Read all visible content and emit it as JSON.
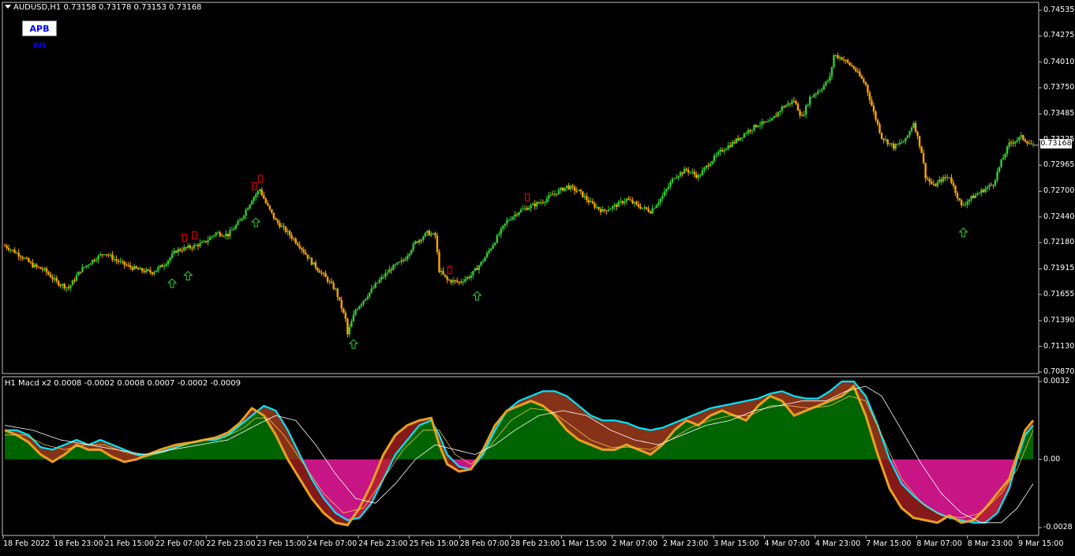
{
  "header": {
    "symbol_info": "AUDUSD,H1  0.73158 0.73178 0.73153 0.73168",
    "apb_button": "APB on",
    "current_price": "0.73168"
  },
  "indicator": {
    "title": "H1 Macd x2 0.0008 -0.0002 0.0008 0.0007 -0.0002 -0.0009"
  },
  "price_axis": {
    "ticks": [
      "0.74535",
      "0.74275",
      "0.74010",
      "0.73750",
      "0.73485",
      "0.73225",
      "0.72965",
      "0.72700",
      "0.72440",
      "0.72180",
      "0.71915",
      "0.71655",
      "0.71390",
      "0.71130",
      "0.70870"
    ]
  },
  "macd_axis": {
    "ticks": [
      "0.0032",
      "0.00",
      "-0.0028"
    ]
  },
  "time_axis": {
    "ticks": [
      "18 Feb 2022",
      "18 Feb 23:00",
      "21 Feb 15:00",
      "22 Feb 07:00",
      "22 Feb 23:00",
      "23 Feb 15:00",
      "24 Feb 07:00",
      "24 Feb 23:00",
      "25 Feb 15:00",
      "28 Feb 07:00",
      "28 Feb 23:00",
      "1 Mar 15:00",
      "2 Mar 07:00",
      "2 Mar 23:00",
      "3 Mar 15:00",
      "4 Mar 07:00",
      "4 Mar 23:00",
      "7 Mar 15:00",
      "8 Mar 07:00",
      "8 Mar 23:00",
      "9 Mar 15:00"
    ]
  },
  "colors": {
    "background": "#000000",
    "bull": "#32cd32",
    "bear": "#ffa500",
    "macd_pos_fill": "#006400",
    "macd_neg_fill": "#c71585",
    "macd_line": "#00e5ff",
    "signal_line": "#e8a020",
    "white_line": "#ffffff",
    "up_arrow": "#32cd32",
    "down_marker": "#ff0000"
  },
  "chart_data": {
    "type": "candlestick",
    "symbol": "AUDUSD",
    "timeframe": "H1",
    "ylim": [
      0.7087,
      0.74535
    ],
    "close_path": [
      [
        0,
        0.7215
      ],
      [
        8,
        0.7205
      ],
      [
        14,
        0.7195
      ],
      [
        20,
        0.719
      ],
      [
        26,
        0.7178
      ],
      [
        32,
        0.7172
      ],
      [
        38,
        0.719
      ],
      [
        44,
        0.72
      ],
      [
        50,
        0.7208
      ],
      [
        56,
        0.72
      ],
      [
        62,
        0.7194
      ],
      [
        68,
        0.719
      ],
      [
        74,
        0.7188
      ],
      [
        80,
        0.7196
      ],
      [
        86,
        0.721
      ],
      [
        94,
        0.7214
      ],
      [
        100,
        0.7218
      ],
      [
        106,
        0.7228
      ],
      [
        112,
        0.7226
      ],
      [
        118,
        0.724
      ],
      [
        124,
        0.7262
      ],
      [
        128,
        0.7272
      ],
      [
        131,
        0.7258
      ],
      [
        136,
        0.724
      ],
      [
        142,
        0.7228
      ],
      [
        148,
        0.7215
      ],
      [
        154,
        0.7198
      ],
      [
        160,
        0.7185
      ],
      [
        166,
        0.717
      ],
      [
        171,
        0.714
      ],
      [
        172,
        0.7125
      ],
      [
        176,
        0.715
      ],
      [
        182,
        0.7165
      ],
      [
        188,
        0.718
      ],
      [
        194,
        0.7192
      ],
      [
        200,
        0.72
      ],
      [
        206,
        0.7218
      ],
      [
        212,
        0.7228
      ],
      [
        216,
        0.7225
      ],
      [
        218,
        0.719
      ],
      [
        222,
        0.718
      ],
      [
        228,
        0.7178
      ],
      [
        234,
        0.7185
      ],
      [
        240,
        0.72
      ],
      [
        246,
        0.722
      ],
      [
        252,
        0.724
      ],
      [
        258,
        0.725
      ],
      [
        264,
        0.7255
      ],
      [
        270,
        0.726
      ],
      [
        276,
        0.7268
      ],
      [
        282,
        0.7275
      ],
      [
        288,
        0.727
      ],
      [
        294,
        0.7258
      ],
      [
        300,
        0.725
      ],
      [
        306,
        0.7255
      ],
      [
        312,
        0.7262
      ],
      [
        318,
        0.7255
      ],
      [
        324,
        0.725
      ],
      [
        330,
        0.7265
      ],
      [
        336,
        0.7285
      ],
      [
        342,
        0.7292
      ],
      [
        348,
        0.7285
      ],
      [
        354,
        0.73
      ],
      [
        360,
        0.7312
      ],
      [
        366,
        0.732
      ],
      [
        372,
        0.733
      ],
      [
        378,
        0.7338
      ],
      [
        384,
        0.734
      ],
      [
        390,
        0.7355
      ],
      [
        396,
        0.7362
      ],
      [
        400,
        0.7345
      ],
      [
        404,
        0.7365
      ],
      [
        410,
        0.7375
      ],
      [
        414,
        0.7385
      ],
      [
        416,
        0.7408
      ],
      [
        420,
        0.7405
      ],
      [
        426,
        0.7395
      ],
      [
        432,
        0.7378
      ],
      [
        436,
        0.735
      ],
      [
        440,
        0.7325
      ],
      [
        446,
        0.7315
      ],
      [
        452,
        0.7322
      ],
      [
        456,
        0.734
      ],
      [
        460,
        0.731
      ],
      [
        462,
        0.7285
      ],
      [
        466,
        0.7275
      ],
      [
        470,
        0.7282
      ],
      [
        474,
        0.7285
      ],
      [
        476,
        0.7275
      ],
      [
        478,
        0.7265
      ],
      [
        480,
        0.7255
      ],
      [
        484,
        0.7262
      ],
      [
        490,
        0.727
      ],
      [
        496,
        0.7278
      ],
      [
        500,
        0.73
      ],
      [
        504,
        0.7318
      ],
      [
        510,
        0.7325
      ],
      [
        516,
        0.7316
      ]
    ],
    "up_arrows": [
      84,
      92,
      126,
      175,
      237,
      481
    ],
    "down_markers": [
      90,
      95,
      125,
      128,
      223,
      262
    ]
  },
  "macd_data": {
    "ylim": [
      -0.0028,
      0.0032
    ],
    "hist": [
      [
        0,
        0.0012
      ],
      [
        6,
        0.0012
      ],
      [
        12,
        0.001
      ],
      [
        18,
        0.0005
      ],
      [
        24,
        0.0004
      ],
      [
        30,
        0.0006
      ],
      [
        36,
        0.0008
      ],
      [
        42,
        0.0006
      ],
      [
        48,
        0.0008
      ],
      [
        54,
        0.0006
      ],
      [
        60,
        0.0004
      ],
      [
        66,
        0.0002
      ],
      [
        72,
        0.0002
      ],
      [
        78,
        0.0003
      ],
      [
        86,
        0.0005
      ],
      [
        94,
        0.0007
      ],
      [
        100,
        0.0008
      ],
      [
        106,
        0.0008
      ],
      [
        112,
        0.001
      ],
      [
        118,
        0.0014
      ],
      [
        124,
        0.0018
      ],
      [
        130,
        0.0022
      ],
      [
        136,
        0.002
      ],
      [
        142,
        0.0012
      ],
      [
        148,
        0.0002
      ],
      [
        154,
        -0.0008
      ],
      [
        160,
        -0.0016
      ],
      [
        166,
        -0.0022
      ],
      [
        172,
        -0.0025
      ],
      [
        178,
        -0.0024
      ],
      [
        184,
        -0.0018
      ],
      [
        190,
        -0.0008
      ],
      [
        196,
        0.0002
      ],
      [
        202,
        0.0008
      ],
      [
        208,
        0.0014
      ],
      [
        214,
        0.0016
      ],
      [
        218,
        0.001
      ],
      [
        222,
        0.0002
      ],
      [
        228,
        -0.0003
      ],
      [
        234,
        -0.0004
      ],
      [
        240,
        0.0002
      ],
      [
        246,
        0.0012
      ],
      [
        252,
        0.002
      ],
      [
        258,
        0.0024
      ],
      [
        264,
        0.0026
      ],
      [
        270,
        0.0028
      ],
      [
        276,
        0.0028
      ],
      [
        282,
        0.0026
      ],
      [
        288,
        0.0022
      ],
      [
        294,
        0.0018
      ],
      [
        300,
        0.0016
      ],
      [
        306,
        0.0016
      ],
      [
        312,
        0.0015
      ],
      [
        318,
        0.0013
      ],
      [
        324,
        0.0012
      ],
      [
        330,
        0.0013
      ],
      [
        336,
        0.0015
      ],
      [
        342,
        0.0017
      ],
      [
        348,
        0.0019
      ],
      [
        354,
        0.0021
      ],
      [
        360,
        0.0022
      ],
      [
        366,
        0.0023
      ],
      [
        372,
        0.0024
      ],
      [
        378,
        0.0025
      ],
      [
        384,
        0.0027
      ],
      [
        390,
        0.0028
      ],
      [
        396,
        0.0026
      ],
      [
        402,
        0.0025
      ],
      [
        408,
        0.0025
      ],
      [
        414,
        0.0028
      ],
      [
        420,
        0.0032
      ],
      [
        426,
        0.0032
      ],
      [
        432,
        0.0026
      ],
      [
        438,
        0.0014
      ],
      [
        444,
        0.0
      ],
      [
        450,
        -0.001
      ],
      [
        456,
        -0.0015
      ],
      [
        462,
        -0.0019
      ],
      [
        468,
        -0.0022
      ],
      [
        474,
        -0.0024
      ],
      [
        480,
        -0.0025
      ],
      [
        486,
        -0.0026
      ],
      [
        492,
        -0.0026
      ],
      [
        498,
        -0.0022
      ],
      [
        504,
        -0.0012
      ],
      [
        508,
        0.0
      ],
      [
        512,
        0.001
      ],
      [
        516,
        0.0014
      ]
    ],
    "fast": [
      [
        0,
        0.0012
      ],
      [
        6,
        0.001
      ],
      [
        12,
        0.0007
      ],
      [
        18,
        0.0002
      ],
      [
        24,
        -0.0001
      ],
      [
        30,
        0.0002
      ],
      [
        36,
        0.0006
      ],
      [
        42,
        0.0004
      ],
      [
        48,
        0.0004
      ],
      [
        54,
        0.0001
      ],
      [
        60,
        -0.0001
      ],
      [
        66,
        0.0
      ],
      [
        72,
        0.0002
      ],
      [
        78,
        0.0004
      ],
      [
        86,
        0.0006
      ],
      [
        94,
        0.0007
      ],
      [
        100,
        0.0008
      ],
      [
        106,
        0.0009
      ],
      [
        112,
        0.0011
      ],
      [
        118,
        0.0015
      ],
      [
        124,
        0.0021
      ],
      [
        130,
        0.0018
      ],
      [
        136,
        0.001
      ],
      [
        142,
        0.0
      ],
      [
        148,
        -0.0008
      ],
      [
        154,
        -0.0016
      ],
      [
        160,
        -0.0022
      ],
      [
        166,
        -0.0026
      ],
      [
        172,
        -0.0027
      ],
      [
        178,
        -0.002
      ],
      [
        184,
        -0.001
      ],
      [
        190,
        0.0002
      ],
      [
        196,
        0.001
      ],
      [
        202,
        0.0014
      ],
      [
        208,
        0.0016
      ],
      [
        214,
        0.0017
      ],
      [
        218,
        0.0006
      ],
      [
        222,
        -0.0002
      ],
      [
        228,
        -0.0005
      ],
      [
        234,
        -0.0004
      ],
      [
        240,
        0.0004
      ],
      [
        246,
        0.0014
      ],
      [
        252,
        0.002
      ],
      [
        258,
        0.0022
      ],
      [
        264,
        0.0024
      ],
      [
        270,
        0.0022
      ],
      [
        276,
        0.0018
      ],
      [
        282,
        0.0012
      ],
      [
        288,
        0.0008
      ],
      [
        294,
        0.0006
      ],
      [
        300,
        0.0004
      ],
      [
        306,
        0.0004
      ],
      [
        312,
        0.0006
      ],
      [
        318,
        0.0004
      ],
      [
        324,
        0.0002
      ],
      [
        330,
        0.0006
      ],
      [
        336,
        0.0012
      ],
      [
        342,
        0.0016
      ],
      [
        348,
        0.0014
      ],
      [
        354,
        0.0018
      ],
      [
        360,
        0.002
      ],
      [
        366,
        0.0018
      ],
      [
        372,
        0.0016
      ],
      [
        378,
        0.0022
      ],
      [
        384,
        0.0026
      ],
      [
        390,
        0.0024
      ],
      [
        396,
        0.0018
      ],
      [
        402,
        0.002
      ],
      [
        408,
        0.0022
      ],
      [
        414,
        0.0024
      ],
      [
        420,
        0.0026
      ],
      [
        426,
        0.003
      ],
      [
        432,
        0.0018
      ],
      [
        438,
        0.0002
      ],
      [
        444,
        -0.0012
      ],
      [
        450,
        -0.002
      ],
      [
        456,
        -0.0024
      ],
      [
        462,
        -0.0025
      ],
      [
        468,
        -0.0026
      ],
      [
        474,
        -0.0023
      ],
      [
        480,
        -0.0026
      ],
      [
        486,
        -0.0025
      ],
      [
        492,
        -0.002
      ],
      [
        498,
        -0.0014
      ],
      [
        504,
        -0.0008
      ],
      [
        508,
        0.0002
      ],
      [
        512,
        0.0012
      ],
      [
        516,
        0.0016
      ]
    ],
    "signal": [
      [
        0,
        0.001
      ],
      [
        10,
        0.001
      ],
      [
        20,
        0.0006
      ],
      [
        30,
        0.0004
      ],
      [
        40,
        0.0006
      ],
      [
        50,
        0.0006
      ],
      [
        60,
        0.0003
      ],
      [
        70,
        0.0001
      ],
      [
        80,
        0.0003
      ],
      [
        90,
        0.0006
      ],
      [
        100,
        0.0008
      ],
      [
        110,
        0.0009
      ],
      [
        120,
        0.0013
      ],
      [
        126,
        0.0017
      ],
      [
        132,
        0.0017
      ],
      [
        140,
        0.001
      ],
      [
        150,
        -0.0002
      ],
      [
        160,
        -0.0014
      ],
      [
        170,
        -0.0022
      ],
      [
        180,
        -0.002
      ],
      [
        190,
        -0.0008
      ],
      [
        200,
        0.0004
      ],
      [
        210,
        0.0012
      ],
      [
        218,
        0.0012
      ],
      [
        226,
        0.0002
      ],
      [
        234,
        -0.0002
      ],
      [
        244,
        0.0006
      ],
      [
        254,
        0.0016
      ],
      [
        264,
        0.0021
      ],
      [
        274,
        0.002
      ],
      [
        284,
        0.0014
      ],
      [
        294,
        0.0008
      ],
      [
        304,
        0.0005
      ],
      [
        314,
        0.0005
      ],
      [
        324,
        0.0004
      ],
      [
        334,
        0.0008
      ],
      [
        344,
        0.0013
      ],
      [
        354,
        0.0016
      ],
      [
        364,
        0.0018
      ],
      [
        374,
        0.0018
      ],
      [
        384,
        0.0022
      ],
      [
        394,
        0.0022
      ],
      [
        404,
        0.0021
      ],
      [
        414,
        0.0022
      ],
      [
        424,
        0.0026
      ],
      [
        432,
        0.0024
      ],
      [
        440,
        0.001
      ],
      [
        450,
        -0.0008
      ],
      [
        460,
        -0.0018
      ],
      [
        470,
        -0.0023
      ],
      [
        480,
        -0.0024
      ],
      [
        490,
        -0.0022
      ],
      [
        500,
        -0.0014
      ],
      [
        508,
        -0.0004
      ],
      [
        516,
        0.0012
      ]
    ],
    "slow": [
      [
        0,
        0.0014
      ],
      [
        14,
        0.0012
      ],
      [
        28,
        0.0008
      ],
      [
        42,
        0.0006
      ],
      [
        56,
        0.0004
      ],
      [
        70,
        0.0002
      ],
      [
        84,
        0.0004
      ],
      [
        98,
        0.0006
      ],
      [
        112,
        0.0008
      ],
      [
        126,
        0.0014
      ],
      [
        136,
        0.0018
      ],
      [
        146,
        0.0016
      ],
      [
        156,
        0.0006
      ],
      [
        166,
        -0.0006
      ],
      [
        176,
        -0.0016
      ],
      [
        186,
        -0.0018
      ],
      [
        196,
        -0.001
      ],
      [
        206,
        0.0
      ],
      [
        216,
        0.0006
      ],
      [
        226,
        0.0004
      ],
      [
        236,
        0.0002
      ],
      [
        246,
        0.0006
      ],
      [
        256,
        0.0012
      ],
      [
        268,
        0.0018
      ],
      [
        280,
        0.002
      ],
      [
        292,
        0.0018
      ],
      [
        304,
        0.0012
      ],
      [
        316,
        0.0008
      ],
      [
        328,
        0.0006
      ],
      [
        340,
        0.001
      ],
      [
        352,
        0.0014
      ],
      [
        364,
        0.0016
      ],
      [
        376,
        0.002
      ],
      [
        388,
        0.0022
      ],
      [
        400,
        0.0024
      ],
      [
        412,
        0.0024
      ],
      [
        422,
        0.0028
      ],
      [
        432,
        0.003
      ],
      [
        440,
        0.0026
      ],
      [
        450,
        0.0012
      ],
      [
        460,
        -0.0002
      ],
      [
        470,
        -0.0014
      ],
      [
        480,
        -0.0022
      ],
      [
        490,
        -0.0026
      ],
      [
        500,
        -0.0026
      ],
      [
        508,
        -0.002
      ],
      [
        516,
        -0.001
      ]
    ]
  }
}
